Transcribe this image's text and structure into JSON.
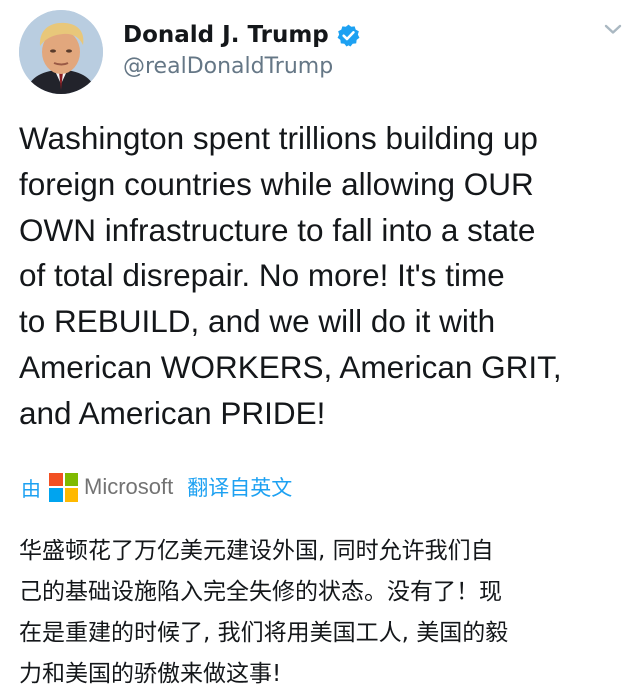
{
  "user": {
    "display_name": "Donald J. Trump",
    "handle": "@realDonaldTrump",
    "verified": true
  },
  "tweet": {
    "text_lines": [
      "Washington spent trillions building up",
      "foreign countries while allowing OUR",
      "OWN infrastructure to fall into a state",
      "of total disrepair. No more! It's time",
      "to REBUILD, and we will do it with",
      "American WORKERS, American GRIT,",
      "and American PRIDE!"
    ]
  },
  "translation": {
    "by_label": "由",
    "provider": "Microsoft",
    "link_label": "翻译自英文",
    "text_lines": [
      "华盛顿花了万亿美元建设外国, 同时允许我们自",
      "己的基础设施陷入完全失修的状态。没有了！现",
      "在是重建的时候了, 我们将用美国工人, 美国的毅",
      "力和美国的骄傲来做这事!"
    ]
  },
  "icons": {
    "verified": "verified-badge-icon",
    "menu": "chevron-down-icon",
    "ms_logo": "microsoft-logo-icon"
  },
  "colors": {
    "accent": "#1da1f2",
    "text": "#14171a",
    "secondary": "#657786",
    "ms_red": "#f25022",
    "ms_green": "#7fba00",
    "ms_blue": "#00a4ef",
    "ms_yellow": "#ffb900"
  }
}
